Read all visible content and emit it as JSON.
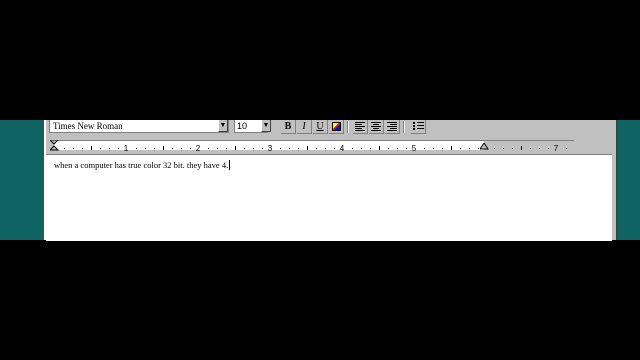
{
  "toolbar": {
    "font_name": "Times New Roman",
    "font_size": "10",
    "bold_label": "B",
    "italic_label": "I",
    "underline_label": "U",
    "icons": [
      "color-icon",
      "align-left-icon",
      "align-center-icon",
      "align-right-icon",
      "bullets-icon"
    ]
  },
  "ruler": {
    "numbers": [
      "1",
      "2",
      "3",
      "4",
      "5",
      "7"
    ]
  },
  "document": {
    "text": "when a computer has true color 32 bit. they have 4."
  },
  "colors": {
    "desktop": "#0f6363",
    "chrome": "#c0c0c0",
    "paper": "#ffffff"
  }
}
